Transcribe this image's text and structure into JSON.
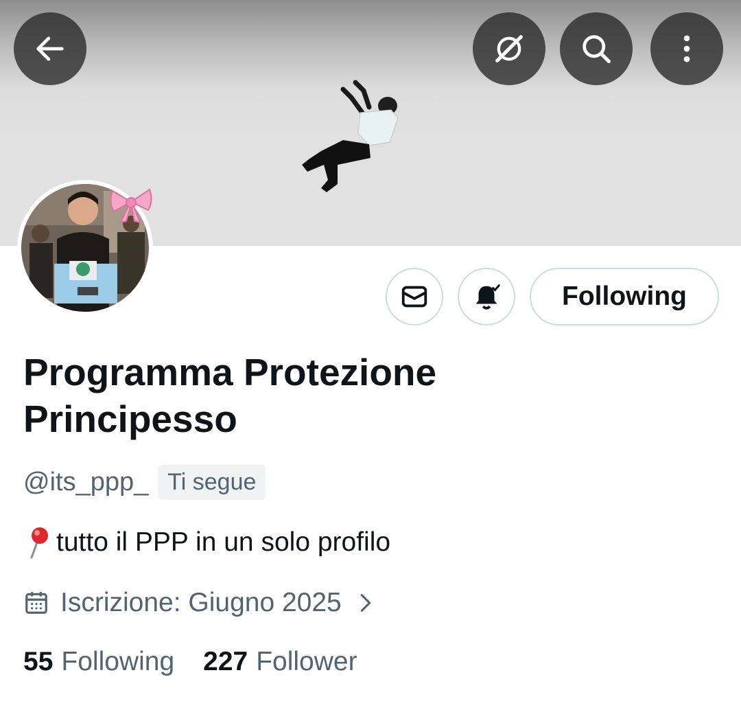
{
  "header": {
    "back_icon": "arrow-left-icon",
    "grok_icon": "grok-icon",
    "search_icon": "search-icon",
    "more_icon": "more-vertical-icon"
  },
  "actions": {
    "message_icon": "envelope-icon",
    "notifications_icon": "bell-check-icon",
    "following_label": "Following"
  },
  "profile": {
    "display_name": "Programma Protezione Principesso",
    "handle": "@its_ppp_",
    "follows_you_label": "Ti segue",
    "bio_emoji": "pin-icon",
    "bio": "tutto il PPP in un solo profilo",
    "joined": "Iscrizione: Giugno 2025",
    "following_count": "55",
    "following_label": "Following",
    "followers_count": "227",
    "followers_label": "Follower"
  },
  "colors": {
    "text_primary": "#0f1419",
    "text_secondary": "#536471",
    "border": "#cfd9de",
    "badge_bg": "#eff3f4"
  }
}
